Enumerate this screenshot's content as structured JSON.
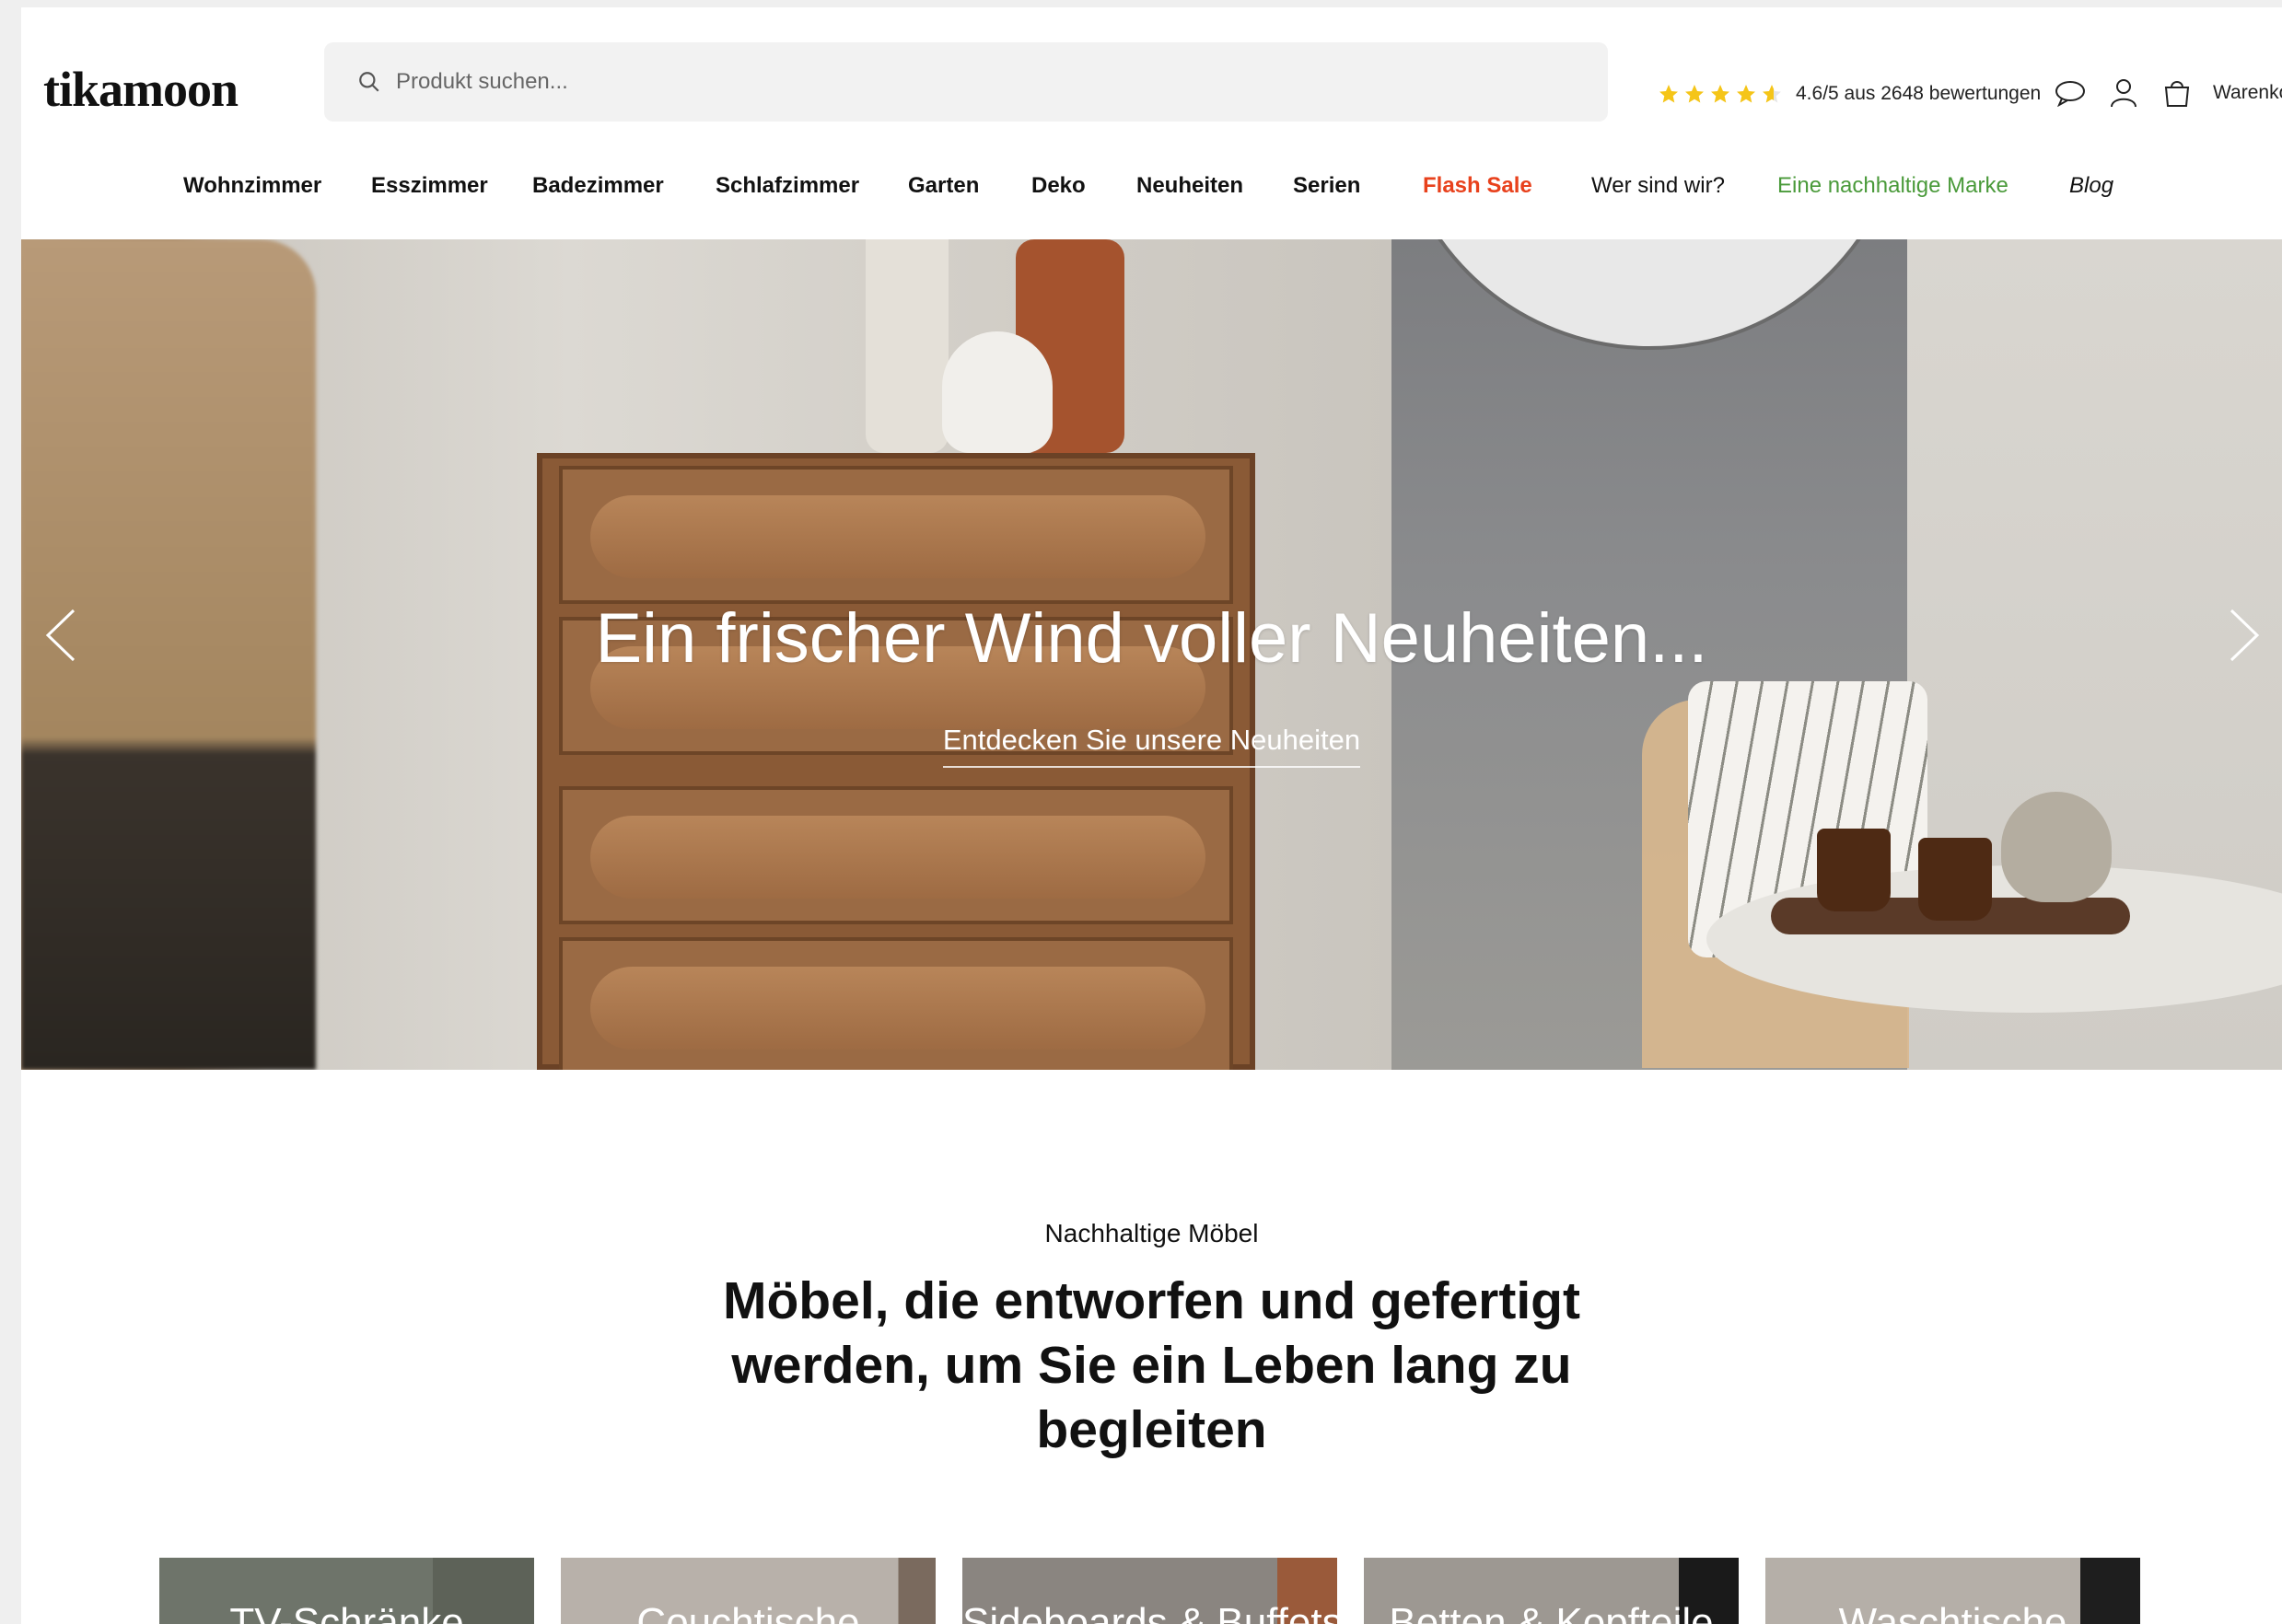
{
  "header": {
    "logo": "tikamoon",
    "search_placeholder": "Produkt suchen...",
    "rating_text": "4.6/5 aus 2648 bewertungen",
    "rating_value": 4.6,
    "rating_max": 5,
    "cart_label": "Warenkorb"
  },
  "nav": {
    "items": [
      {
        "label": "Wohnzimmer"
      },
      {
        "label": "Esszimmer"
      },
      {
        "label": "Badezimmer"
      },
      {
        "label": "Schlafzimmer"
      },
      {
        "label": "Garten"
      },
      {
        "label": "Deko"
      },
      {
        "label": "Neuheiten"
      },
      {
        "label": "Serien"
      },
      {
        "label": "Flash Sale"
      },
      {
        "label": "Wer sind wir?"
      },
      {
        "label": "Eine nachhaltige Marke"
      },
      {
        "label": "Blog"
      }
    ]
  },
  "hero": {
    "title": "Ein frischer Wind voller Neuheiten...",
    "cta": "Entdecken Sie unsere Neuheiten"
  },
  "section": {
    "kicker": "Nachhaltige Möbel",
    "headline": "Möbel, die entworfen und gefertigt werden, um Sie ein Leben lang zu begleiten"
  },
  "categories": [
    {
      "label": "TV-Schränke"
    },
    {
      "label": "Couchtische"
    },
    {
      "label": "Sideboards & Buffets"
    },
    {
      "label": "Betten & Kopfteile"
    },
    {
      "label": "Waschtische"
    }
  ],
  "colors": {
    "flash_sale": "#e8411c",
    "sustainable": "#4a9a3a",
    "star": "#f5c518"
  }
}
